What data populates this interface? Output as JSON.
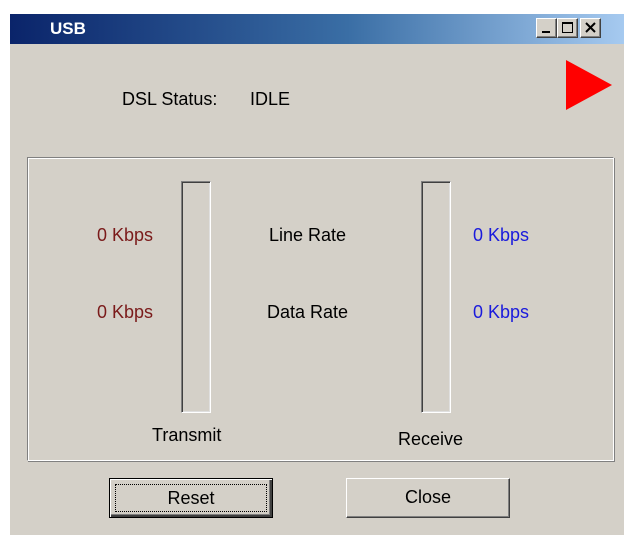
{
  "window": {
    "title": "USB",
    "controls": [
      "minimize-icon",
      "maximize-icon",
      "close-icon"
    ]
  },
  "status": {
    "label": "DSL Status:",
    "value": "IDLE",
    "indicator_icon": "play-triangle-icon",
    "indicator_color": "#ff0000"
  },
  "rates": {
    "line_rate_label": "Line Rate",
    "data_rate_label": "Data Rate",
    "transmit": {
      "caption": "Transmit",
      "line_rate": "0 Kbps",
      "data_rate": "0 Kbps",
      "level_percent": 0,
      "color": "#7a1a1a"
    },
    "receive": {
      "caption": "Receive",
      "line_rate": "0 Kbps",
      "data_rate": "0 Kbps",
      "level_percent": 0,
      "color": "#1a1adc"
    }
  },
  "buttons": {
    "reset_label": "Reset",
    "close_label": "Close"
  }
}
